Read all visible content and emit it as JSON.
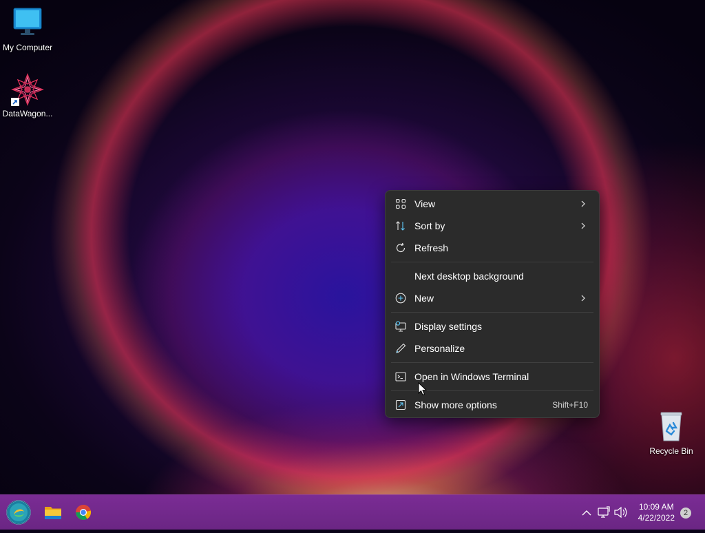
{
  "desktop": {
    "icons": [
      {
        "label": "My Computer"
      },
      {
        "label": "DataWagon..."
      },
      {
        "label": "Recycle Bin"
      }
    ]
  },
  "context_menu": {
    "items": [
      {
        "label": "View",
        "icon": "view-grid-icon",
        "submenu": true
      },
      {
        "label": "Sort by",
        "icon": "sort-icon",
        "submenu": true
      },
      {
        "label": "Refresh",
        "icon": "refresh-icon",
        "submenu": false
      },
      {
        "label": "Next desktop background",
        "icon": "",
        "submenu": false
      },
      {
        "label": "New",
        "icon": "add-circle-icon",
        "submenu": true
      },
      {
        "label": "Display settings",
        "icon": "display-settings-icon",
        "submenu": false
      },
      {
        "label": "Personalize",
        "icon": "pen-icon",
        "submenu": false
      },
      {
        "label": "Open in Windows Terminal",
        "icon": "terminal-icon",
        "submenu": false
      },
      {
        "label": "Show more options",
        "icon": "show-more-icon",
        "shortcut": "Shift+F10"
      }
    ]
  },
  "taskbar": {
    "pinned": [
      {
        "name": "start-button",
        "icon": "start-orb-icon"
      },
      {
        "name": "file-explorer",
        "icon": "folder-icon"
      },
      {
        "name": "chrome",
        "icon": "chrome-icon"
      }
    ],
    "clock": {
      "time": "10:09 AM",
      "date": "4/22/2022"
    },
    "notifications": {
      "count": "2"
    }
  },
  "colors": {
    "menu_bg": "#2b2b2b",
    "taskbar_bg": "#6b2684",
    "accent_blue": "#60cdff"
  }
}
